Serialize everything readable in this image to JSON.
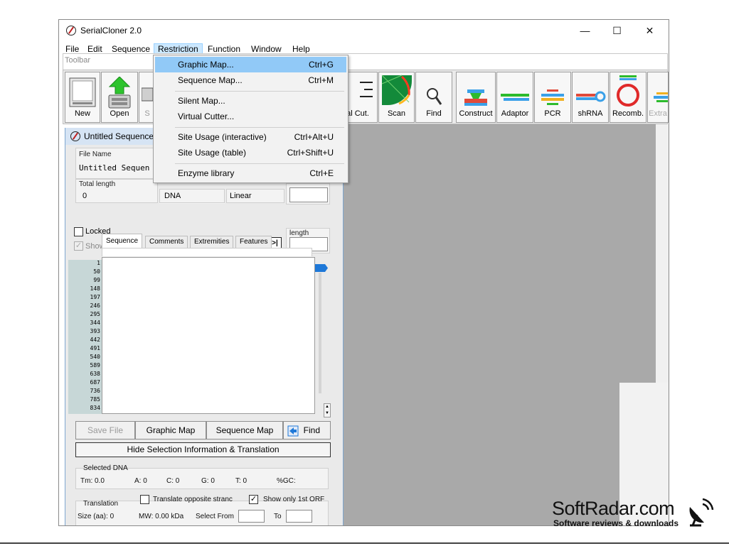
{
  "window": {
    "title": "SerialCloner 2.0",
    "controls": {
      "minimize": "—",
      "maximize": "☐",
      "close": "✕"
    }
  },
  "menubar": [
    "File",
    "Edit",
    "Sequence",
    "Restriction",
    "Function",
    "Window",
    "Help"
  ],
  "toolbar": {
    "label": "Toolbar",
    "buttons": [
      {
        "label": "New",
        "icon": "document-icon"
      },
      {
        "label": "Open",
        "icon": "open-icon"
      },
      {
        "label": "S",
        "icon": "save-icon"
      },
      {
        "label": "ual Cut.",
        "icon": "virtual-cut-icon"
      },
      {
        "label": "Scan",
        "icon": "scan-icon"
      },
      {
        "label": "Find",
        "icon": "magnifier-icon"
      },
      {
        "label": "Construct",
        "icon": "construct-icon"
      },
      {
        "label": "Adaptor",
        "icon": "adaptor-icon"
      },
      {
        "label": "PCR",
        "icon": "pcr-icon"
      },
      {
        "label": "shRNA",
        "icon": "shrna-icon"
      },
      {
        "label": "Recomb.",
        "icon": "recombination-icon"
      },
      {
        "label": "Extra",
        "icon": "extra-icon"
      }
    ]
  },
  "restriction_menu": [
    {
      "label": "Graphic Map...",
      "shortcut": "Ctrl+G"
    },
    {
      "label": "Sequence Map...",
      "shortcut": "Ctrl+M"
    },
    {
      "label": "Silent Map...",
      "shortcut": ""
    },
    {
      "label": "Virtual Cutter...",
      "shortcut": ""
    },
    {
      "label": "Site Usage (interactive)",
      "shortcut": "Ctrl+Alt+U"
    },
    {
      "label": "Site Usage (table)",
      "shortcut": "Ctrl+Shift+U"
    },
    {
      "label": "Enzyme library",
      "shortcut": "Ctrl+E"
    }
  ],
  "child": {
    "title": "Untitled Sequence",
    "file_name_label": "File Name",
    "file_name_value": "Untitled Sequen",
    "total_length_label": "Total length",
    "total_length_value": "0",
    "type_value": "DNA",
    "topology_value": "Linear",
    "length_label": "length",
    "locked_label": "Locked",
    "show_features_label": "Show features",
    "nav_buttons": [
      "|<",
      ">|"
    ],
    "tabs": [
      "Sequence",
      "Comments",
      "Extremities",
      "Features"
    ],
    "ruler": [
      "1",
      "50",
      "99",
      "148",
      "197",
      "246",
      "295",
      "344",
      "393",
      "442",
      "491",
      "540",
      "589",
      "638",
      "687",
      "736",
      "785",
      "834"
    ],
    "buttons": {
      "save_file": "Save File",
      "graphic_map": "Graphic Map",
      "sequence_map": "Sequence Map",
      "find": "Find",
      "hide_selection": "Hide Selection Information & Translation"
    },
    "selected_dna": {
      "label": "Selected DNA",
      "tm": "Tm: 0.0",
      "a": "A: 0",
      "c": "C: 0",
      "g": "G: 0",
      "t": "T: 0",
      "gc": "%GC:"
    },
    "translation": {
      "label": "Translation",
      "opposite": "Translate opposite stranc",
      "show_first_orf": "Show only 1st ORF",
      "size": "Size (aa): 0",
      "mw": "MW: 0.00 kDa",
      "select_from": "Select From",
      "to": "To"
    }
  },
  "watermark": {
    "title": "SoftRadar.com",
    "subtitle": "Software reviews & downloads"
  }
}
